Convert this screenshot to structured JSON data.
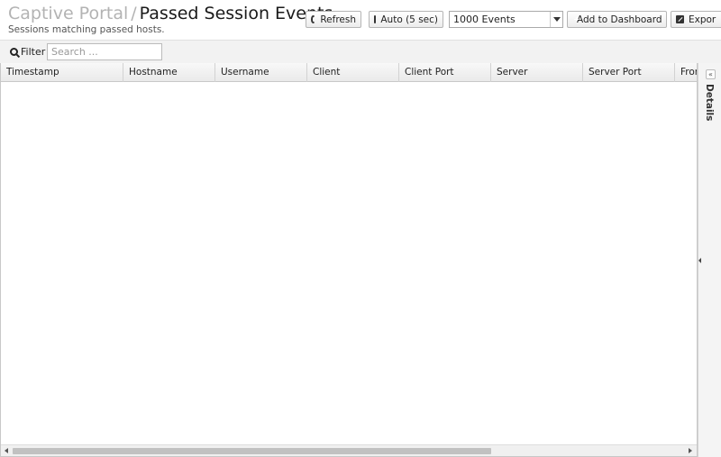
{
  "header": {
    "breadcrumb_parent": "Captive Portal",
    "breadcrumb_separator": "/",
    "title": "Passed Session Events",
    "subtitle": "Sessions matching passed hosts."
  },
  "toolbar": {
    "refresh_label": "Refresh",
    "auto_label": "Auto (5 sec)",
    "events_selected": "1000 Events",
    "add_dashboard_label": "Add to Dashboard",
    "export_label": "Expor"
  },
  "filter": {
    "label": "Filter",
    "placeholder": "Search ..."
  },
  "grid": {
    "columns": [
      "Timestamp",
      "Hostname",
      "Username",
      "Client",
      "Client Port",
      "Server",
      "Server Port",
      "From"
    ],
    "rows": []
  },
  "panel": {
    "title": "Details",
    "collapse_icon": "«"
  },
  "icons": [
    "refresh-icon",
    "checkbox-icon",
    "chevron-down-icon",
    "add-circle-icon",
    "export-icon",
    "search-icon"
  ]
}
